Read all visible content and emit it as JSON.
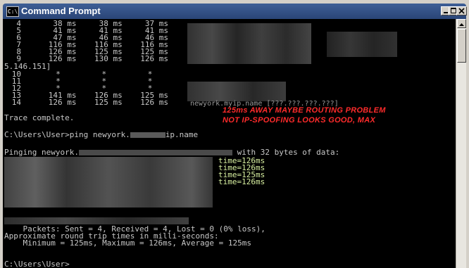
{
  "window": {
    "title": "Command Prompt",
    "icon_text": "C:\\"
  },
  "console": {
    "hops": [
      {
        "hop": "4",
        "t1": "38 ms",
        "t2": "38 ms",
        "t3": "37 ms"
      },
      {
        "hop": "5",
        "t1": "41 ms",
        "t2": "41 ms",
        "t3": "41 ms"
      },
      {
        "hop": "6",
        "t1": "47 ms",
        "t2": "46 ms",
        "t3": "46 ms"
      },
      {
        "hop": "7",
        "t1": "116 ms",
        "t2": "116 ms",
        "t3": "116 ms"
      },
      {
        "hop": "8",
        "t1": "126 ms",
        "t2": "125 ms",
        "t3": "125 ms"
      },
      {
        "hop": "9",
        "t1": "126 ms",
        "t2": "130 ms",
        "t3": "126 ms"
      }
    ],
    "wrap_line": "5.146.151]",
    "hops2": [
      {
        "hop": "10",
        "t1": "*",
        "t2": "*",
        "t3": "*"
      },
      {
        "hop": "11",
        "t1": "*",
        "t2": "*",
        "t3": "*"
      },
      {
        "hop": "12",
        "t1": "*",
        "t2": "*",
        "t3": "*"
      },
      {
        "hop": "13",
        "t1": "141 ms",
        "t2": "126 ms",
        "t3": "125 ms"
      },
      {
        "hop": "14",
        "t1": "126 ms",
        "t2": "125 ms",
        "t3": "126 ms"
      }
    ],
    "hop14_host": "newyork.myip.name [???.???.???.???]",
    "trace_complete": "Trace complete.",
    "prompt_ping": "C:\\Users\\User>ping newyork.",
    "prompt_ping_tail": "ip.name",
    "pinging_prefix": "Pinging newyork.",
    "pinging_suffix": "with 32 bytes of data:",
    "reply_times": [
      "time=126ms",
      "time=126ms",
      "time=125ms",
      "time=126ms"
    ],
    "packets": "    Packets: Sent = 4, Received = 4, Lost = 0 (0% loss),",
    "approx": "Approximate round trip times in milli-seconds:",
    "minmax": "    Minimum = 125ms, Maximum = 126ms, Average = 125ms",
    "final_prompt": "C:\\Users\\User>_"
  },
  "annotation": {
    "line1": "125ms AWAY MAYBE ROUTING PROBLEM",
    "line2": "NOT IP-SPOOFING LOOKS GOOD, MAX",
    "color": "#ff2b2b"
  },
  "colors": {
    "console_bg": "#000000",
    "console_text": "#c8c8c8",
    "title_bar": "#2a4577"
  }
}
